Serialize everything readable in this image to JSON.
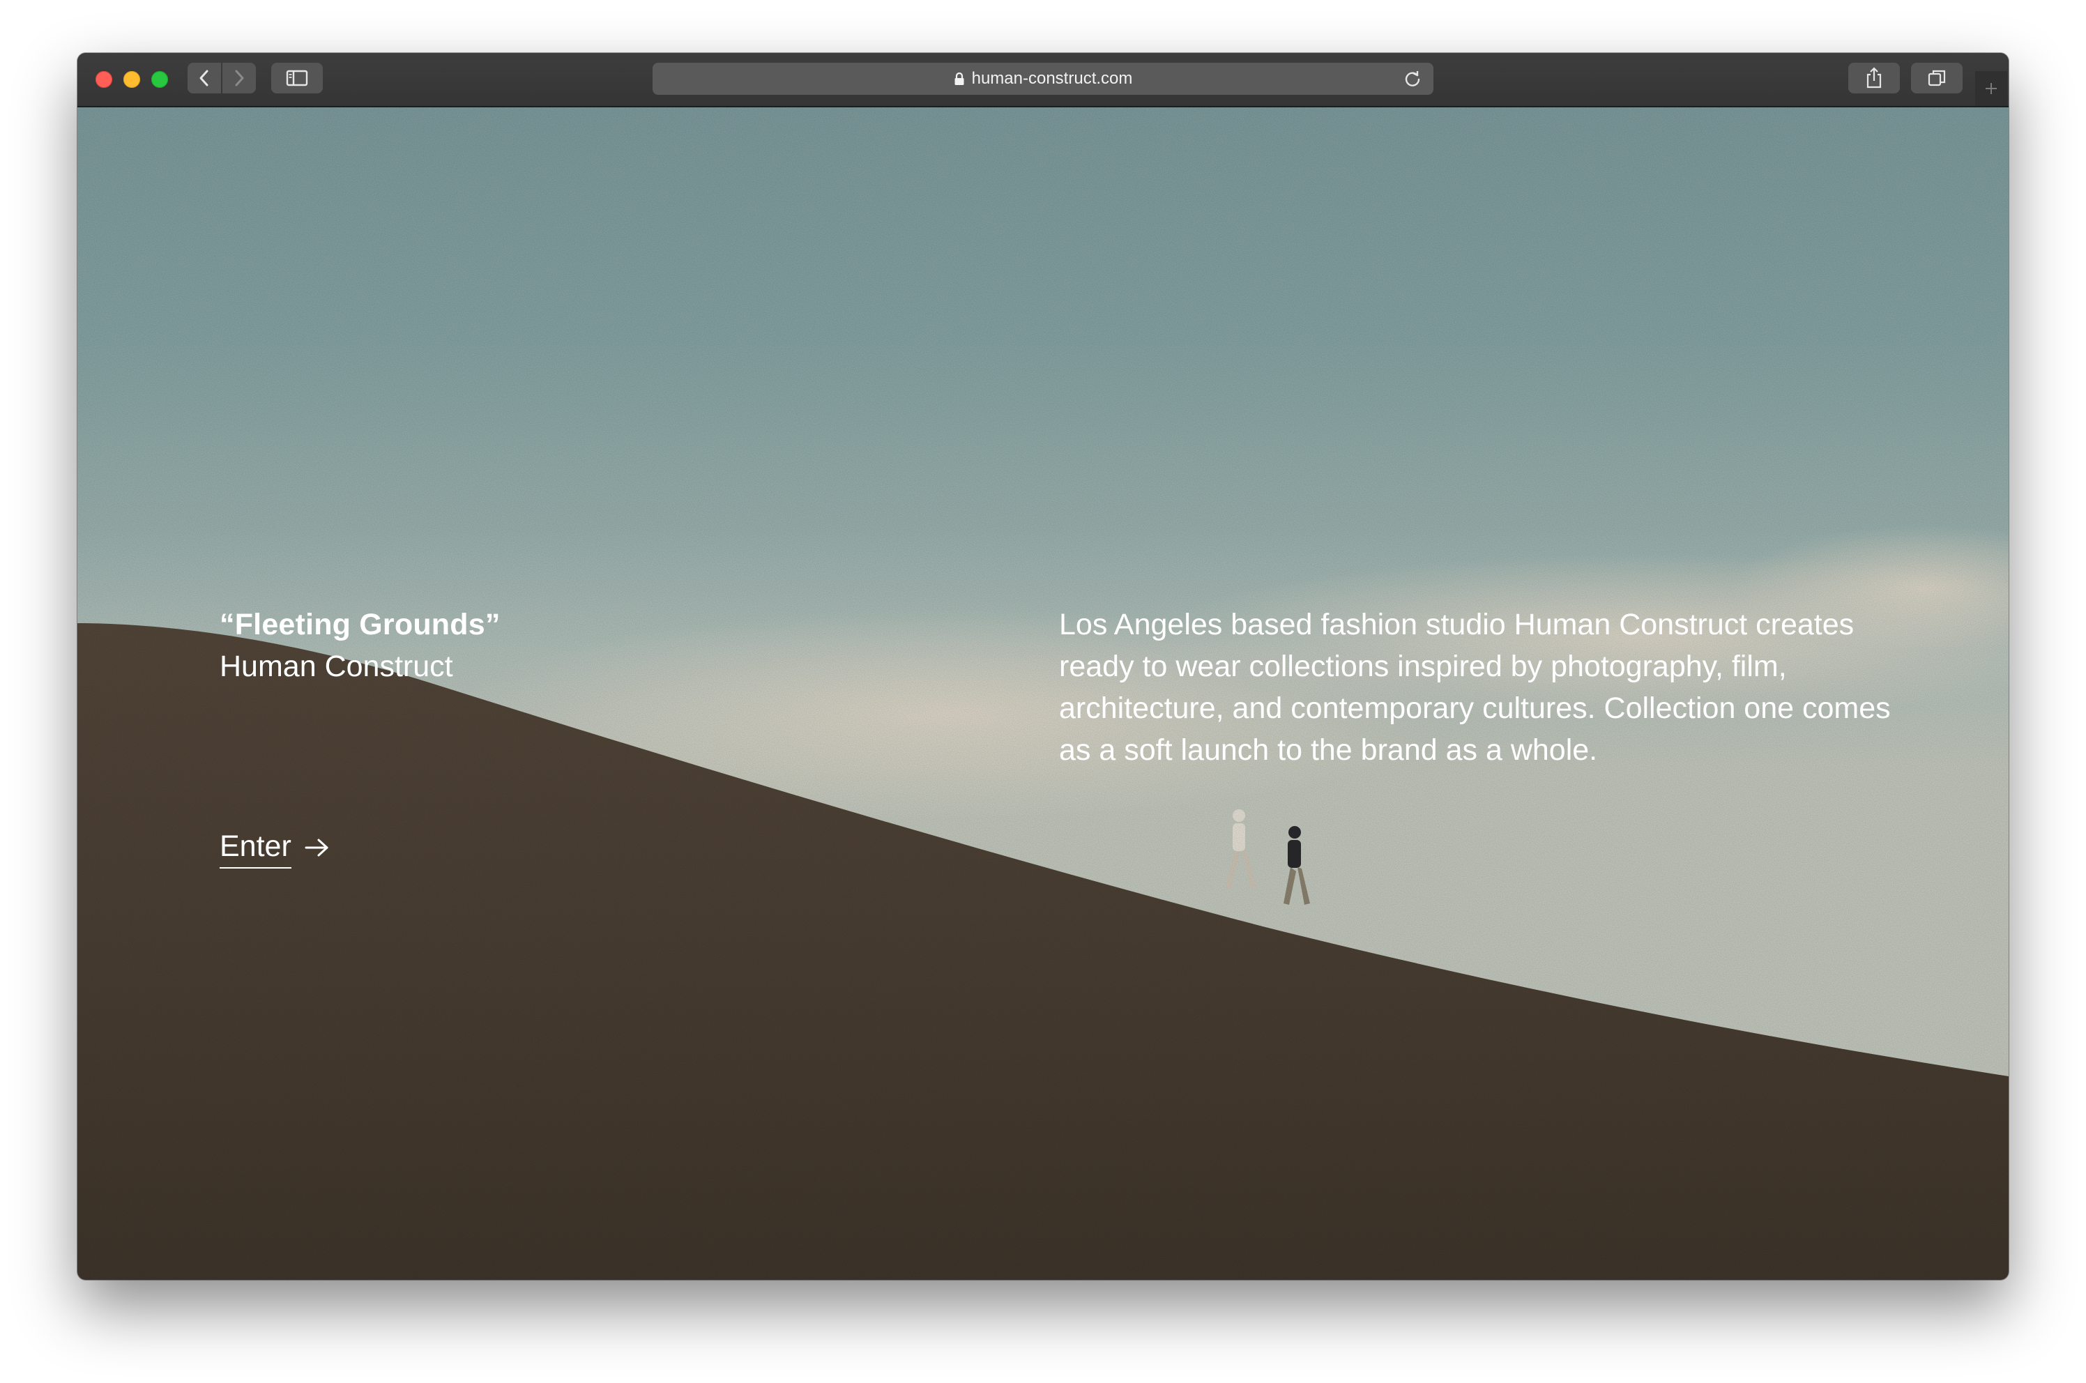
{
  "browser": {
    "url": "human-construct.com",
    "icons": {
      "back": "chevron-left-icon",
      "forward": "chevron-right-icon",
      "sidebar": "sidebar-icon",
      "lock": "lock-icon",
      "reload": "reload-icon",
      "share": "share-icon",
      "tabs": "tabs-icon",
      "new_tab": "plus-icon"
    }
  },
  "hero": {
    "collection_name": "“Fleeting Grounds”",
    "brand": "Human Construct",
    "enter_label": "Enter",
    "description": "Los Angeles based fashion studio Human Construct creates ready to wear collections inspired by photography, film, architecture, and contemporary cultures. Collection one comes as a soft launch to the brand as a whole."
  },
  "colors": {
    "traffic_close": "#ff5f57",
    "traffic_minimize": "#febc2e",
    "traffic_maximize": "#28c840",
    "text": "#ffffff",
    "sky": "#88a6a6",
    "hill": "#4a3f33"
  }
}
